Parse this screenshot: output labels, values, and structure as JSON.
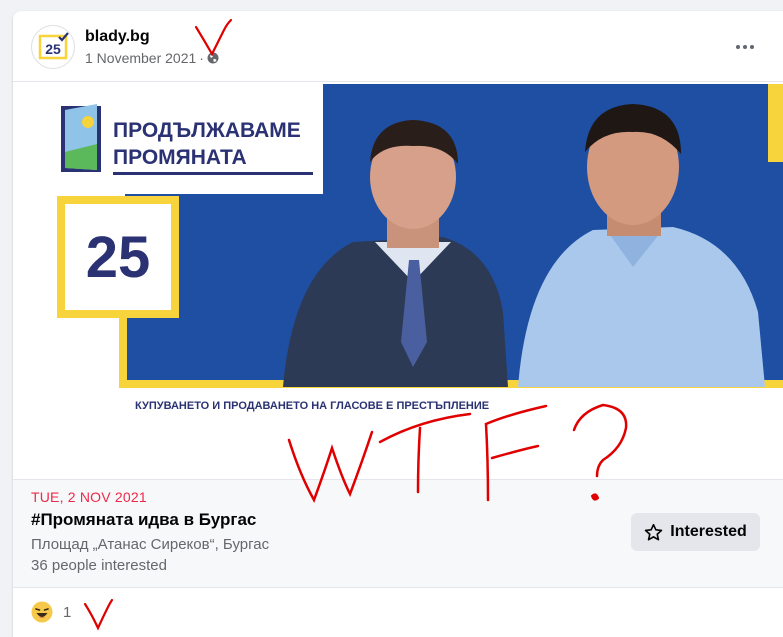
{
  "post": {
    "page_name": "blady.bg",
    "date": "1 November 2021",
    "separator": "·",
    "avatar_number": "25"
  },
  "poster": {
    "logo_line1": "ПРОДЪЛЖАВАМЕ",
    "logo_line2": "ПРОМЯНАТА",
    "number": "25",
    "disclaimer": "КУПУВАНЕТО И ПРОДАВАНЕТО НА ГЛАСОВЕ Е ПРЕСТЪПЛЕНИЕ"
  },
  "event": {
    "date": "TUE, 2 NOV 2021",
    "title": "#Промяната идва в Бургас",
    "place": "Площад „Атанас Сиреков“, Бургас",
    "interested_count": "36 people interested",
    "interested_label": "Interested"
  },
  "reactions": {
    "icon": "haha-emoji-icon",
    "count": "1"
  },
  "annotation": {
    "text": "WTF?"
  },
  "colors": {
    "brand_blue": "#1e4fa3",
    "brand_yellow": "#f7d33c",
    "navy": "#2b3273",
    "event_date_red": "#f02849",
    "annotation_red": "#e00000"
  }
}
